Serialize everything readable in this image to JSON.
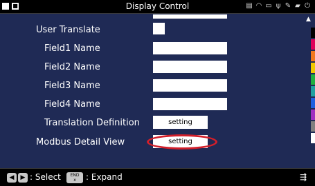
{
  "window": {
    "title": "Display Control"
  },
  "rows": {
    "user_translate": {
      "label": "User Translate"
    },
    "field1": {
      "label": "Field1 Name",
      "value": ""
    },
    "field2": {
      "label": "Field2 Name",
      "value": ""
    },
    "field3": {
      "label": "Field3 Name",
      "value": ""
    },
    "field4": {
      "label": "Field4 Name",
      "value": ""
    },
    "translation": {
      "label": "Translation Definition",
      "button": "setting"
    },
    "modbus": {
      "label": "Modbus Detail View",
      "button": "setting"
    }
  },
  "statusbar": {
    "select_text": ": Select",
    "end_key_top": "END",
    "end_key_bottom": "x",
    "expand_text": ": Expand",
    "right_icon": "⇶"
  },
  "colors": {
    "background": "#1f2a55",
    "highlight": "#d21f2a",
    "channels": [
      "#000000",
      "#e0005a",
      "#f07820",
      "#f0c800",
      "#20b040",
      "#20a0a0",
      "#2060e0",
      "#a030c0",
      "#808080",
      "#ffffff"
    ]
  },
  "icons": [
    "printer-icon",
    "wifi-icon",
    "network-icon",
    "usb-icon",
    "settings-icon",
    "sd-card-icon",
    "power-icon"
  ]
}
